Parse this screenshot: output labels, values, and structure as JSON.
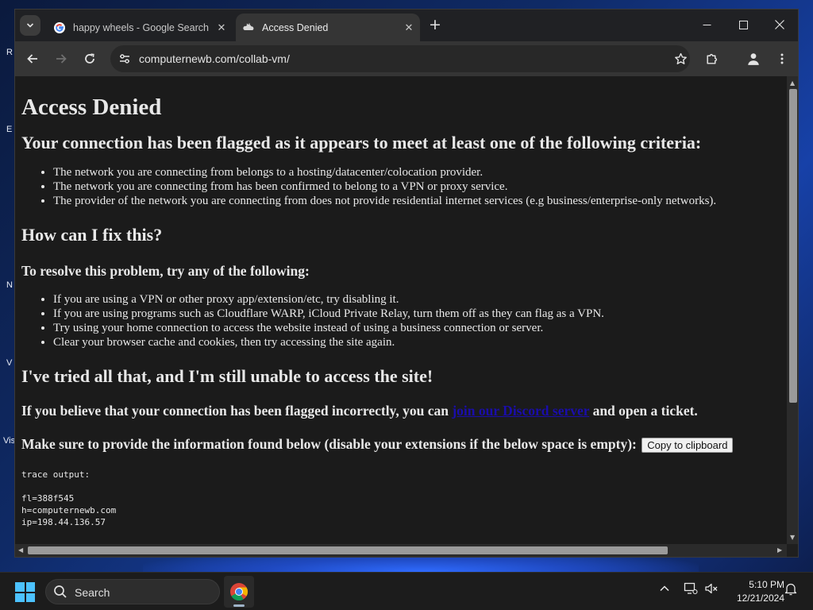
{
  "desktop": {
    "icon_labels": [
      "R",
      "E",
      "N",
      "V",
      "Vis"
    ]
  },
  "browser": {
    "tabs": [
      {
        "title": "happy wheels - Google Search",
        "icon": "google-icon",
        "active": false
      },
      {
        "title": "Access Denied",
        "icon": "cloudflare-icon",
        "active": true
      }
    ],
    "new_tab": "+",
    "url": "computernewb.com/collab-vm/"
  },
  "page": {
    "title": "Access Denied",
    "criteria_heading": "Your connection has been flagged as it appears to meet at least one of the following criteria:",
    "criteria": [
      "The network you are connecting from belongs to a hosting/datacenter/colocation provider.",
      "The network you are connecting from has been confirmed to belong to a VPN or proxy service.",
      "The provider of the network you are connecting from does not provide residential internet services (e.g business/enterprise-only networks)."
    ],
    "fix_heading": "How can I fix this?",
    "resolve_heading": "To resolve this problem, try any of the following:",
    "fixes": [
      "If you are using a VPN or other proxy app/extension/etc, try disabling it.",
      "If you are using programs such as Cloudflare WARP, iCloud Private Relay, turn them off as they can flag as a VPN.",
      "Try using your home connection to access the website instead of using a business connection or server.",
      "Clear your browser cache and cookies, then try accessing the site again."
    ],
    "tried_heading": "I've tried all that, and I'm still unable to access the site!",
    "incorrect_prefix": "If you believe that your connection has been flagged incorrectly, you can",
    "discord_link": "join our Discord server",
    "incorrect_suffix": "and open a ticket.",
    "info_text": "Make sure to provide the information found below (disable your extensions if the below space is empty):",
    "copy_button": "Copy to clipboard",
    "trace_output": "trace output:\n\nfl=388f545\nh=computernewb.com\nip=198.44.136.57",
    "link_color": "#1a0dab"
  },
  "taskbar": {
    "search_label": "Search",
    "time": "5:10 PM",
    "date": "12/21/2024",
    "accent": "#4cc2ff"
  }
}
